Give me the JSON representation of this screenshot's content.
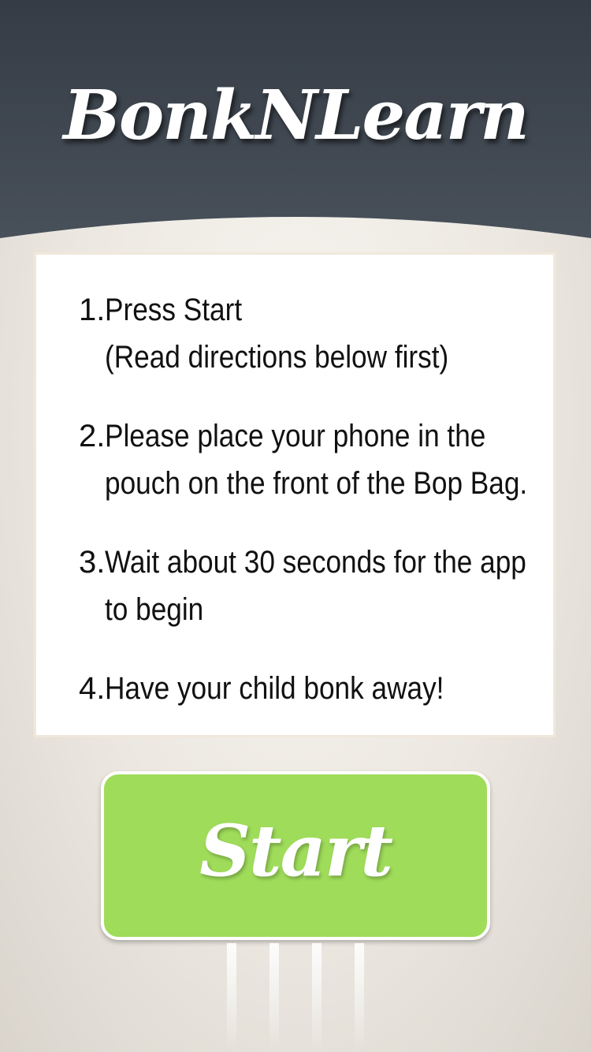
{
  "header": {
    "title": "BonkNLearn",
    "colors": {
      "top": "#353c45",
      "bottom": "#48505a"
    }
  },
  "instructions": [
    {
      "number": "1.",
      "lines": [
        "Press Start",
        "(Read directions below first)"
      ]
    },
    {
      "number": "2.",
      "lines": [
        "Please place your phone in the",
        "pouch on the front of the Bop Bag."
      ]
    },
    {
      "number": "3.",
      "lines": [
        "Wait about 30 seconds for the app",
        "to begin"
      ]
    },
    {
      "number": "4.",
      "lines": [
        "Have your child bonk away!"
      ]
    }
  ],
  "start_button": {
    "label": "Start",
    "color": "#9fdc5a"
  }
}
